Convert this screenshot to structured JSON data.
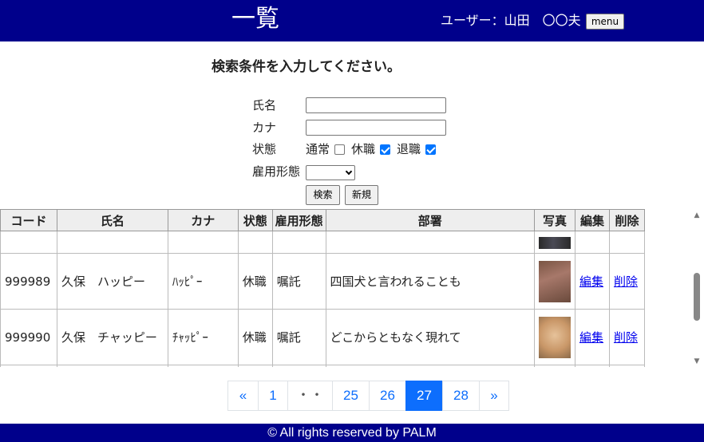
{
  "header": {
    "title": "一覧",
    "user": "ユーザー：山田　〇〇夫",
    "menu_label": "menu"
  },
  "search": {
    "prompt": "検索条件を入力してください。",
    "name_label": "氏名",
    "name_value": "",
    "kana_label": "カナ",
    "kana_value": "",
    "status_label": "状態",
    "status_options": [
      {
        "label": "通常",
        "checked": false
      },
      {
        "label": "休職",
        "checked": true
      },
      {
        "label": "退職",
        "checked": true
      }
    ],
    "employment_label": "雇用形態",
    "employment_value": "",
    "search_button": "検索",
    "new_button": "新規"
  },
  "table": {
    "headers": [
      "コード",
      "氏名",
      "カナ",
      "状態",
      "雇用形態",
      "部署",
      "写真",
      "編集",
      "削除"
    ],
    "rows": [
      {
        "code": "999989",
        "name": "久保　ハッピー",
        "kana": "ﾊｯﾋﾟｰ",
        "status": "休職",
        "employment": "嘱託",
        "dept": "四国犬と言われることも",
        "photo": "dog-photo",
        "edit": "編集",
        "delete": "削除"
      },
      {
        "code": "999990",
        "name": "久保　チャッピー",
        "kana": "ﾁｬｯﾋﾟｰ",
        "status": "休職",
        "employment": "嘱託",
        "dept": "どこからともなく現れて",
        "photo": "dog-photo",
        "edit": "編集",
        "delete": "削除"
      }
    ]
  },
  "pager": {
    "items": [
      "«",
      "1",
      "・・",
      "25",
      "26",
      "27",
      "28",
      "»"
    ],
    "current": "27"
  },
  "footer": {
    "text": "© All rights reserved by PALM"
  },
  "colors": {
    "header_bg": "#00008b",
    "pager_active": "#0d6efd",
    "link": "#0000ee"
  }
}
